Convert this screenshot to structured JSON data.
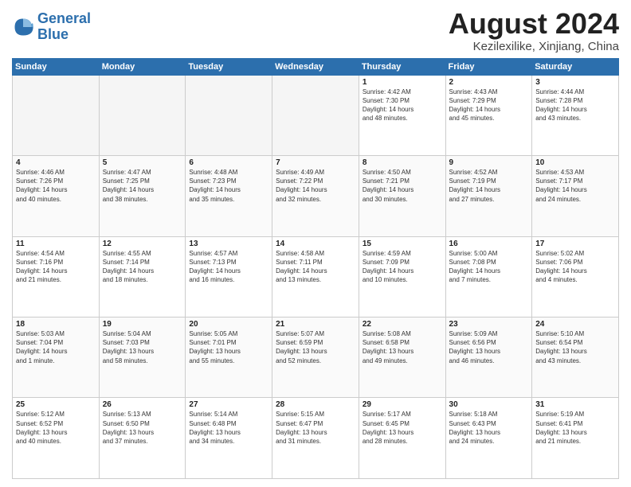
{
  "logo": {
    "line1": "General",
    "line2": "Blue"
  },
  "title": "August 2024",
  "subtitle": "Kezilexilike, Xinjiang, China",
  "days_of_week": [
    "Sunday",
    "Monday",
    "Tuesday",
    "Wednesday",
    "Thursday",
    "Friday",
    "Saturday"
  ],
  "weeks": [
    [
      {
        "num": "",
        "info": "",
        "empty": true
      },
      {
        "num": "",
        "info": "",
        "empty": true
      },
      {
        "num": "",
        "info": "",
        "empty": true
      },
      {
        "num": "",
        "info": "",
        "empty": true
      },
      {
        "num": "1",
        "info": "Sunrise: 4:42 AM\nSunset: 7:30 PM\nDaylight: 14 hours\nand 48 minutes.",
        "empty": false
      },
      {
        "num": "2",
        "info": "Sunrise: 4:43 AM\nSunset: 7:29 PM\nDaylight: 14 hours\nand 45 minutes.",
        "empty": false
      },
      {
        "num": "3",
        "info": "Sunrise: 4:44 AM\nSunset: 7:28 PM\nDaylight: 14 hours\nand 43 minutes.",
        "empty": false
      }
    ],
    [
      {
        "num": "4",
        "info": "Sunrise: 4:46 AM\nSunset: 7:26 PM\nDaylight: 14 hours\nand 40 minutes.",
        "empty": false
      },
      {
        "num": "5",
        "info": "Sunrise: 4:47 AM\nSunset: 7:25 PM\nDaylight: 14 hours\nand 38 minutes.",
        "empty": false
      },
      {
        "num": "6",
        "info": "Sunrise: 4:48 AM\nSunset: 7:23 PM\nDaylight: 14 hours\nand 35 minutes.",
        "empty": false
      },
      {
        "num": "7",
        "info": "Sunrise: 4:49 AM\nSunset: 7:22 PM\nDaylight: 14 hours\nand 32 minutes.",
        "empty": false
      },
      {
        "num": "8",
        "info": "Sunrise: 4:50 AM\nSunset: 7:21 PM\nDaylight: 14 hours\nand 30 minutes.",
        "empty": false
      },
      {
        "num": "9",
        "info": "Sunrise: 4:52 AM\nSunset: 7:19 PM\nDaylight: 14 hours\nand 27 minutes.",
        "empty": false
      },
      {
        "num": "10",
        "info": "Sunrise: 4:53 AM\nSunset: 7:17 PM\nDaylight: 14 hours\nand 24 minutes.",
        "empty": false
      }
    ],
    [
      {
        "num": "11",
        "info": "Sunrise: 4:54 AM\nSunset: 7:16 PM\nDaylight: 14 hours\nand 21 minutes.",
        "empty": false
      },
      {
        "num": "12",
        "info": "Sunrise: 4:55 AM\nSunset: 7:14 PM\nDaylight: 14 hours\nand 18 minutes.",
        "empty": false
      },
      {
        "num": "13",
        "info": "Sunrise: 4:57 AM\nSunset: 7:13 PM\nDaylight: 14 hours\nand 16 minutes.",
        "empty": false
      },
      {
        "num": "14",
        "info": "Sunrise: 4:58 AM\nSunset: 7:11 PM\nDaylight: 14 hours\nand 13 minutes.",
        "empty": false
      },
      {
        "num": "15",
        "info": "Sunrise: 4:59 AM\nSunset: 7:09 PM\nDaylight: 14 hours\nand 10 minutes.",
        "empty": false
      },
      {
        "num": "16",
        "info": "Sunrise: 5:00 AM\nSunset: 7:08 PM\nDaylight: 14 hours\nand 7 minutes.",
        "empty": false
      },
      {
        "num": "17",
        "info": "Sunrise: 5:02 AM\nSunset: 7:06 PM\nDaylight: 14 hours\nand 4 minutes.",
        "empty": false
      }
    ],
    [
      {
        "num": "18",
        "info": "Sunrise: 5:03 AM\nSunset: 7:04 PM\nDaylight: 14 hours\nand 1 minute.",
        "empty": false
      },
      {
        "num": "19",
        "info": "Sunrise: 5:04 AM\nSunset: 7:03 PM\nDaylight: 13 hours\nand 58 minutes.",
        "empty": false
      },
      {
        "num": "20",
        "info": "Sunrise: 5:05 AM\nSunset: 7:01 PM\nDaylight: 13 hours\nand 55 minutes.",
        "empty": false
      },
      {
        "num": "21",
        "info": "Sunrise: 5:07 AM\nSunset: 6:59 PM\nDaylight: 13 hours\nand 52 minutes.",
        "empty": false
      },
      {
        "num": "22",
        "info": "Sunrise: 5:08 AM\nSunset: 6:58 PM\nDaylight: 13 hours\nand 49 minutes.",
        "empty": false
      },
      {
        "num": "23",
        "info": "Sunrise: 5:09 AM\nSunset: 6:56 PM\nDaylight: 13 hours\nand 46 minutes.",
        "empty": false
      },
      {
        "num": "24",
        "info": "Sunrise: 5:10 AM\nSunset: 6:54 PM\nDaylight: 13 hours\nand 43 minutes.",
        "empty": false
      }
    ],
    [
      {
        "num": "25",
        "info": "Sunrise: 5:12 AM\nSunset: 6:52 PM\nDaylight: 13 hours\nand 40 minutes.",
        "empty": false
      },
      {
        "num": "26",
        "info": "Sunrise: 5:13 AM\nSunset: 6:50 PM\nDaylight: 13 hours\nand 37 minutes.",
        "empty": false
      },
      {
        "num": "27",
        "info": "Sunrise: 5:14 AM\nSunset: 6:48 PM\nDaylight: 13 hours\nand 34 minutes.",
        "empty": false
      },
      {
        "num": "28",
        "info": "Sunrise: 5:15 AM\nSunset: 6:47 PM\nDaylight: 13 hours\nand 31 minutes.",
        "empty": false
      },
      {
        "num": "29",
        "info": "Sunrise: 5:17 AM\nSunset: 6:45 PM\nDaylight: 13 hours\nand 28 minutes.",
        "empty": false
      },
      {
        "num": "30",
        "info": "Sunrise: 5:18 AM\nSunset: 6:43 PM\nDaylight: 13 hours\nand 24 minutes.",
        "empty": false
      },
      {
        "num": "31",
        "info": "Sunrise: 5:19 AM\nSunset: 6:41 PM\nDaylight: 13 hours\nand 21 minutes.",
        "empty": false
      }
    ]
  ]
}
